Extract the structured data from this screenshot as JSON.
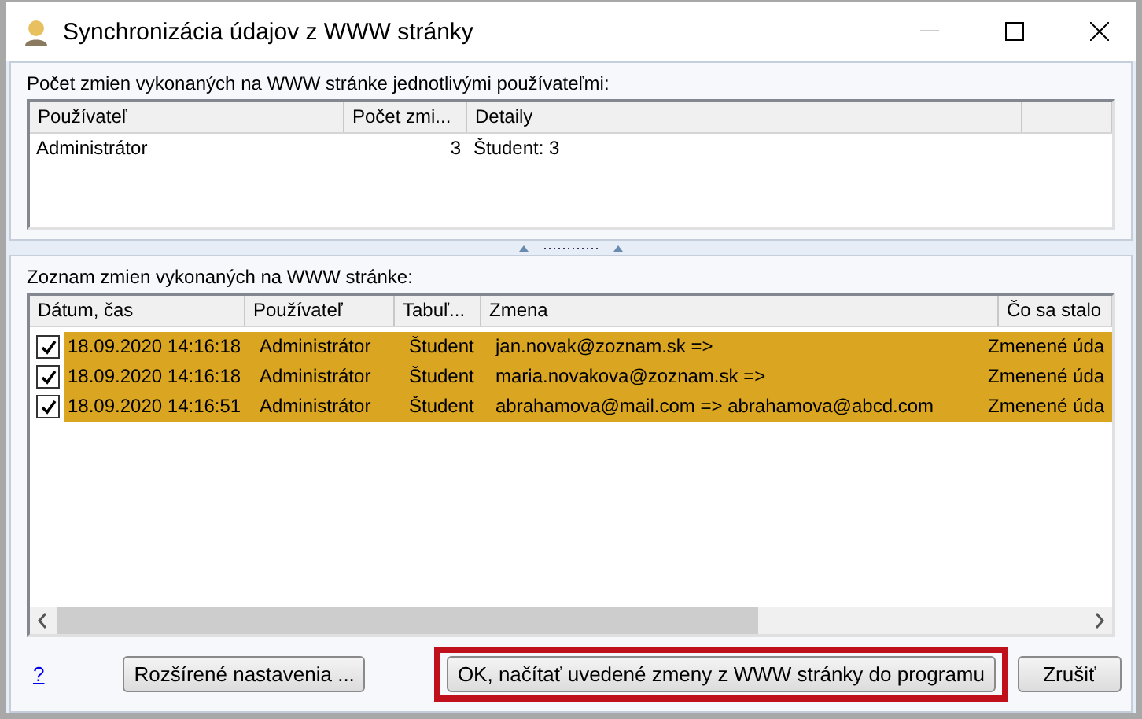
{
  "window": {
    "title": "Synchronizácia údajov z WWW stránky"
  },
  "summary": {
    "label": "Počet zmien vykonaných na WWW stránke jednotlivými používateľmi:",
    "columns": [
      "Používateľ",
      "Počet zmi...",
      "Detaily"
    ],
    "rows": [
      {
        "user": "Administrátor",
        "count": "3",
        "details": "Študent: 3"
      }
    ]
  },
  "changes": {
    "label": "Zoznam zmien vykonaných na WWW stránke:",
    "columns": [
      "Dátum, čas",
      "Používateľ",
      "Tabuľ...",
      "Zmena",
      "Čo sa stalo"
    ],
    "rows": [
      {
        "checked": true,
        "date": "18.09.2020 14:16:18",
        "user": "Administrátor",
        "table": "Študent",
        "change": "jan.novak@zoznam.sk =>",
        "what": "Zmenené úda"
      },
      {
        "checked": true,
        "date": "18.09.2020 14:16:18",
        "user": "Administrátor",
        "table": "Študent",
        "change": "maria.novakova@zoznam.sk =>",
        "what": "Zmenené úda"
      },
      {
        "checked": true,
        "date": "18.09.2020 14:16:51",
        "user": "Administrátor",
        "table": "Študent",
        "change": "abrahamova@mail.com => abrahamova@abcd.com",
        "what": "Zmenené úda"
      }
    ]
  },
  "footer": {
    "help": "?",
    "advanced": "Rozšírené nastavenia ...",
    "ok": "OK, načítať uvedené zmeny z WWW stránky do programu",
    "cancel": "Zrušiť"
  }
}
